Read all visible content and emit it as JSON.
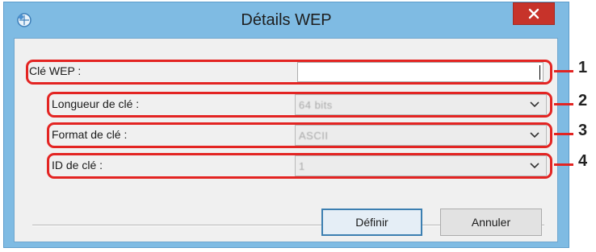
{
  "window": {
    "title": "Détails WEP"
  },
  "fields": {
    "wep_key": {
      "label": "Clé WEP :",
      "value": ""
    },
    "key_length": {
      "label": "Longueur de clé :",
      "value": "64 bits"
    },
    "key_format": {
      "label": "Format de clé :",
      "value": "ASCII"
    },
    "key_id": {
      "label": "ID de clé :",
      "value": "1"
    }
  },
  "buttons": {
    "define": "Définir",
    "cancel": "Annuler"
  },
  "callouts": [
    "1",
    "2",
    "3",
    "4"
  ],
  "colors": {
    "callout_red": "#e32422",
    "title_bar": "#7fbbe3",
    "close_red": "#c7332a"
  }
}
